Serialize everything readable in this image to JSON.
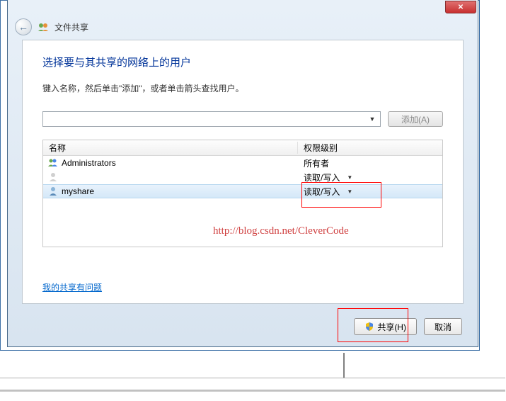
{
  "title_bar": {
    "close_symbol": "✕"
  },
  "nav": {
    "back_arrow": "←",
    "window_title": "文件共享"
  },
  "main": {
    "heading": "选择要与其共享的网络上的用户",
    "instruction": "键入名称，然后单击\"添加\"，或者单击箭头查找用户。",
    "combo_value": "",
    "combo_arrow": "▼",
    "add_button": "添加(A)"
  },
  "table": {
    "header_name": "名称",
    "header_perm": "权限级别",
    "rows": [
      {
        "name": "Administrators",
        "perm": "所有者",
        "has_arrow": false
      },
      {
        "name": "",
        "perm": "读取/写入",
        "has_arrow": true
      },
      {
        "name": "myshare",
        "perm": "读取/写入",
        "has_arrow": true
      }
    ]
  },
  "watermark": "http://blog.csdn.net/CleverCode",
  "help_link": "我的共享有问题",
  "buttons": {
    "share": "共享(H)",
    "cancel": "取消"
  }
}
